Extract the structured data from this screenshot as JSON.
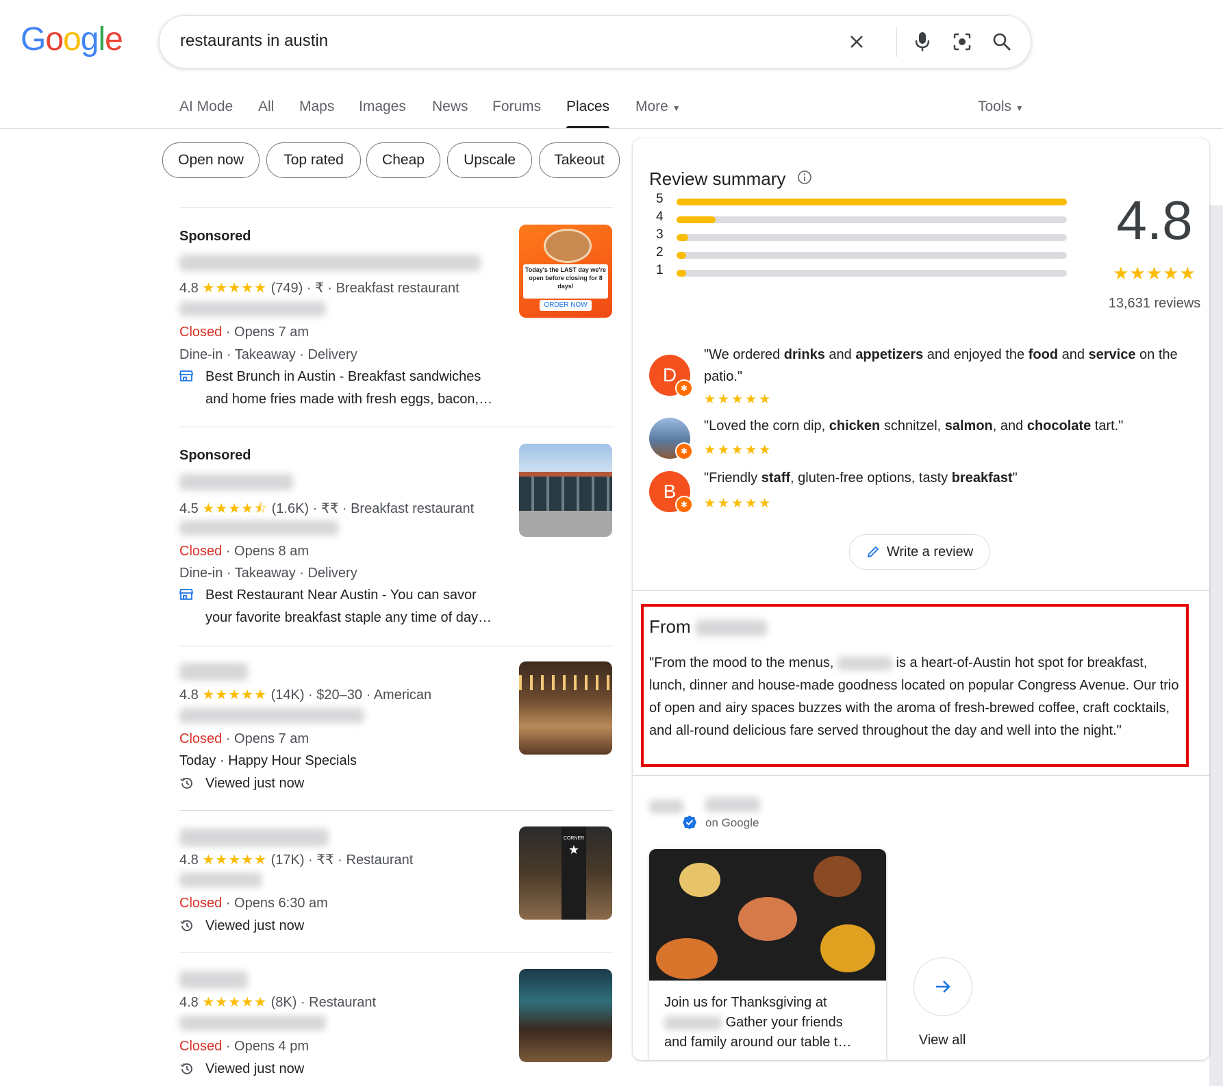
{
  "header": {
    "logo_letters": [
      "G",
      "o",
      "o",
      "g",
      "l",
      "e"
    ],
    "logo_colors": [
      "#4285F4",
      "#EA4335",
      "#FBBC05",
      "#4285F4",
      "#34A853",
      "#EA4335"
    ],
    "search_value": "restaurants in austin"
  },
  "tabs": [
    {
      "label": "AI Mode"
    },
    {
      "label": "All"
    },
    {
      "label": "Maps"
    },
    {
      "label": "Images"
    },
    {
      "label": "News"
    },
    {
      "label": "Forums"
    },
    {
      "label": "Places"
    },
    {
      "label": "More"
    }
  ],
  "tools_label": "Tools",
  "chips": [
    "Open now",
    "Top rated",
    "Cheap",
    "Upscale",
    "Takeout"
  ],
  "listings": [
    {
      "sponsored": "Sponsored",
      "rating": "4.8",
      "stars": "★★★★★",
      "count": "(749)",
      "price": "₹",
      "category": "Breakfast restaurant",
      "closed": "Closed",
      "opens": "Opens 7 am",
      "services": "Dine-in · Takeaway · Delivery",
      "ad_line1": "Best Brunch in Austin - Breakfast sandwiches",
      "ad_line2": "and home fries made with fresh eggs, bacon,…",
      "thumb_text": "Today's the LAST day we're open before closing for 8 days!",
      "thumb_button": "ORDER NOW"
    },
    {
      "sponsored": "Sponsored",
      "rating": "4.5",
      "stars": "★★★★⯪",
      "count": "(1.6K)",
      "price": "₹₹",
      "category": "Breakfast restaurant",
      "closed": "Closed",
      "opens": "Opens 8 am",
      "services": "Dine-in · Takeaway · Delivery",
      "ad_line1": "Best Restaurant Near Austin - You can savor",
      "ad_line2": "your favorite breakfast staple any time of day…"
    },
    {
      "rating": "4.8",
      "stars": "★★★★★",
      "count": "(14K)",
      "price": "$20–30",
      "category": "American",
      "closed": "Closed",
      "opens": "Opens 7 am",
      "extra": "Today · Happy Hour Specials",
      "viewed": "Viewed just now"
    },
    {
      "rating": "4.8",
      "stars": "★★★★★",
      "count": "(17K)",
      "price": "₹₹",
      "category": "Restaurant",
      "closed": "Closed",
      "opens": "Opens 6:30 am",
      "viewed": "Viewed just now",
      "thumb_text": "CORNER"
    },
    {
      "rating": "4.8",
      "stars": "★★★★★",
      "count": "(8K)",
      "category": "Restaurant",
      "closed": "Closed",
      "opens": "Opens 4 pm",
      "viewed": "Viewed just now"
    }
  ],
  "review_summary": {
    "title": "Review summary",
    "score": "4.8",
    "stars": "★★★★★",
    "total": "13,631 reviews",
    "distribution": [
      {
        "label": "5",
        "fraction": 1.0
      },
      {
        "label": "4",
        "fraction": 0.1
      },
      {
        "label": "3",
        "fraction": 0.03
      },
      {
        "label": "2",
        "fraction": 0.015
      },
      {
        "label": "1",
        "fraction": 0.02
      }
    ],
    "write_review": "Write a review"
  },
  "reviews": [
    {
      "initial": "D",
      "color": "#f4511e",
      "stars": "★★★★★",
      "parts": [
        "\"We ordered ",
        "drinks",
        " and ",
        "appetizers",
        " and enjoyed the ",
        "food",
        " and ",
        "service",
        " on the patio.\""
      ]
    },
    {
      "initial": "",
      "color": "#7a9cc6",
      "stars": "★★★★★",
      "parts": [
        "\"Loved the corn dip, ",
        "chicken",
        " schnitzel, ",
        "salmon",
        ", and ",
        "chocolate",
        " tart.\""
      ]
    },
    {
      "initial": "B",
      "color": "#f4511e",
      "stars": "★★★★★",
      "parts": [
        "\"Friendly ",
        "staff",
        ", gluten-free options, tasty ",
        "breakfast",
        "\""
      ]
    }
  ],
  "from_section": {
    "heading": "From",
    "text_start": "\"From the mood to the menus, ",
    "text_rest": " is a heart-of-Austin hot spot for breakfast, lunch, dinner and house-made goodness located on popular Congress Avenue. Our trio of open and airy spaces buzzes with the aroma of fresh-brewed coffee, craft cocktails, and all-round delicious fare served throughout the day and well into the night.\""
  },
  "updates": {
    "on_google": "on Google",
    "post_line1": "Join us for Thanksgiving at",
    "post_line2": "Gather your friends",
    "post_line3": "and family around our table t…",
    "view_all": "View all"
  }
}
